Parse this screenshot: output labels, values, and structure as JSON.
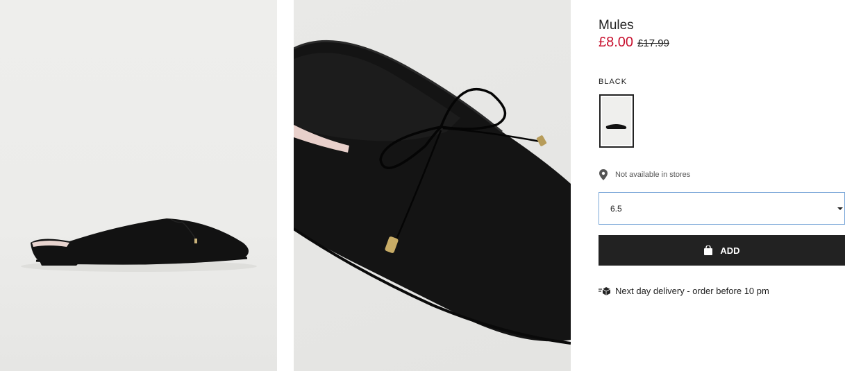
{
  "gallery": {
    "image1_alt": "Black mule side view",
    "image2_alt": "Black mule bow close-up"
  },
  "product": {
    "title": "Mules",
    "price_sale": "£8.00",
    "price_original": "£17.99"
  },
  "color": {
    "label": "BLACK"
  },
  "store": {
    "icon": "location-pin-icon",
    "text": "Not available in stores"
  },
  "size": {
    "value": "6.5"
  },
  "add": {
    "label": "ADD",
    "icon": "shopping-bag-icon"
  },
  "delivery": {
    "icon": "delivery-box-icon",
    "text": "Next day delivery - order before 10 pm"
  },
  "colors": {
    "sale": "#c8102e",
    "button": "#222222",
    "select_border": "#7aa7d8"
  }
}
